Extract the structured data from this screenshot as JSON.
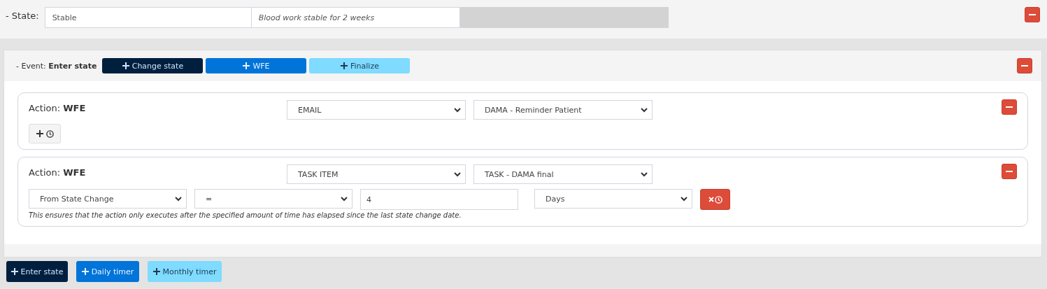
{
  "state": {
    "label": "- State:",
    "name": "Stable",
    "description": "Blood work stable for 2 weeks"
  },
  "event": {
    "prefix": "- Event:",
    "name": "Enter state",
    "buttons": [
      {
        "label": "Change state",
        "kind": "dark"
      },
      {
        "label": "WFE",
        "kind": "primary"
      },
      {
        "label": "Finalize",
        "kind": "info"
      }
    ]
  },
  "actions": [
    {
      "prefix": "Action:",
      "name": "WFE",
      "type": "EMAIL",
      "template": "DAMA - Reminder Patient"
    },
    {
      "prefix": "Action:",
      "name": "WFE",
      "type": "TASK ITEM",
      "template": "TASK - DAMA final",
      "timer": {
        "from": "From State Change",
        "operator": "=",
        "amount": "4",
        "unit": "Days",
        "note": "This ensures that the action only executes after the specified amount of time has elapsed since the last state change date."
      }
    }
  ],
  "add_buttons": [
    {
      "label": "Enter state",
      "kind": "dark"
    },
    {
      "label": "Daily timer",
      "kind": "primary"
    },
    {
      "label": "Monthly timer",
      "kind": "info"
    }
  ]
}
